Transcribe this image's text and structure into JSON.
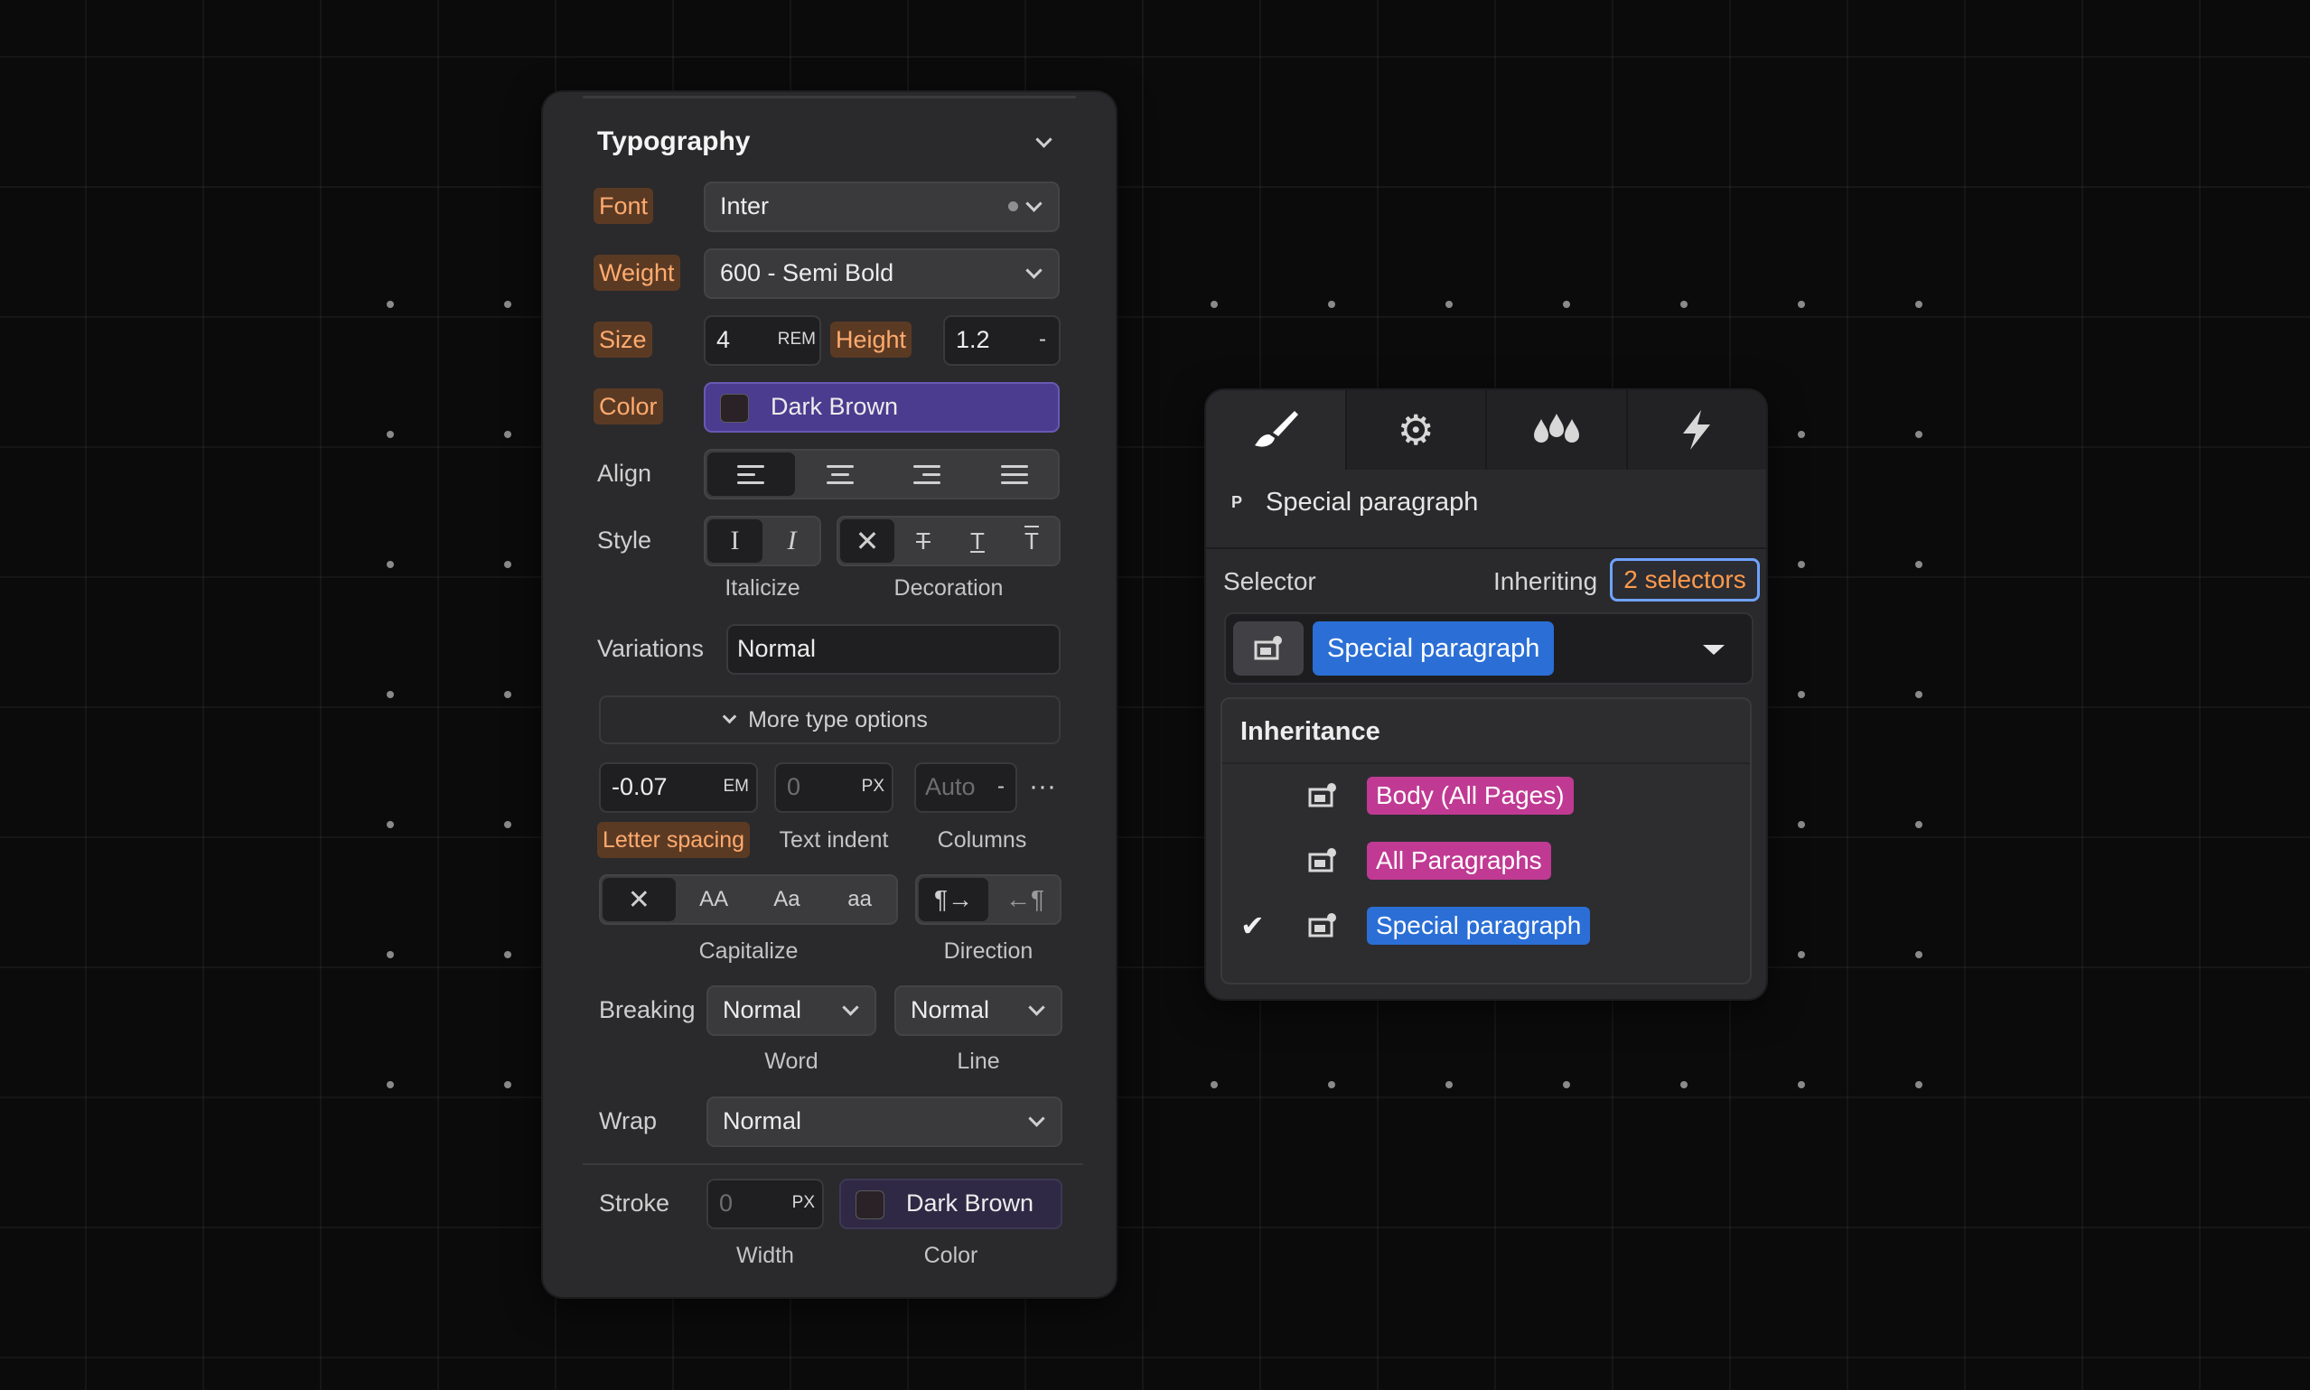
{
  "typography": {
    "title": "Typography",
    "font": {
      "label": "Font",
      "value": "Inter"
    },
    "weight": {
      "label": "Weight",
      "value": "600 - Semi Bold"
    },
    "size": {
      "label": "Size",
      "value": "4",
      "unit": "REM"
    },
    "height": {
      "label": "Height",
      "value": "1.2",
      "unit": "-"
    },
    "color": {
      "label": "Color",
      "value": "Dark Brown",
      "swatch": "#2a2226"
    },
    "align": {
      "label": "Align",
      "options": [
        "left",
        "center",
        "right",
        "justify"
      ],
      "selected": "left"
    },
    "style": {
      "label": "Style",
      "italicize_label": "Italicize",
      "decoration_label": "Decoration"
    },
    "variations": {
      "label": "Variations",
      "value": "Normal"
    },
    "more_type_options": "More type options",
    "letter_spacing": {
      "value": "-0.07",
      "unit": "EM",
      "label": "Letter spacing"
    },
    "text_indent": {
      "value": "0",
      "unit": "PX",
      "label": "Text indent"
    },
    "columns": {
      "value": "Auto",
      "unit": "-",
      "label": "Columns"
    },
    "capitalize": {
      "label": "Capitalize",
      "options": [
        "AA",
        "Aa",
        "aa"
      ]
    },
    "direction": {
      "label": "Direction"
    },
    "breaking": {
      "label": "Breaking",
      "word_value": "Normal",
      "word_label": "Word",
      "line_value": "Normal",
      "line_label": "Line"
    },
    "wrap": {
      "label": "Wrap",
      "value": "Normal"
    },
    "stroke": {
      "label": "Stroke",
      "width_value": "0",
      "width_unit": "PX",
      "width_label": "Width",
      "color_value": "Dark Brown",
      "color_label": "Color"
    }
  },
  "style_panel": {
    "tabs": [
      "brush-icon",
      "gear-icon",
      "drops-icon",
      "lightning-icon"
    ],
    "element_tag": "P",
    "element_name": "Special paragraph",
    "selector_label": "Selector",
    "inheriting_label": "Inheriting",
    "inheriting_count": "2 selectors",
    "current_selector": "Special paragraph",
    "inheritance": {
      "title": "Inheritance",
      "items": [
        {
          "label": "Body (All Pages)",
          "color": "pink",
          "checked": false
        },
        {
          "label": "All Paragraphs",
          "color": "pink",
          "checked": false
        },
        {
          "label": "Special paragraph",
          "color": "blue",
          "checked": true
        }
      ]
    }
  },
  "colors": {
    "accent_orange": "#ffab6e",
    "selected_purple": "#4b3c8f",
    "tag_blue": "#2b6fd6",
    "tag_pink": "#c03a93"
  }
}
